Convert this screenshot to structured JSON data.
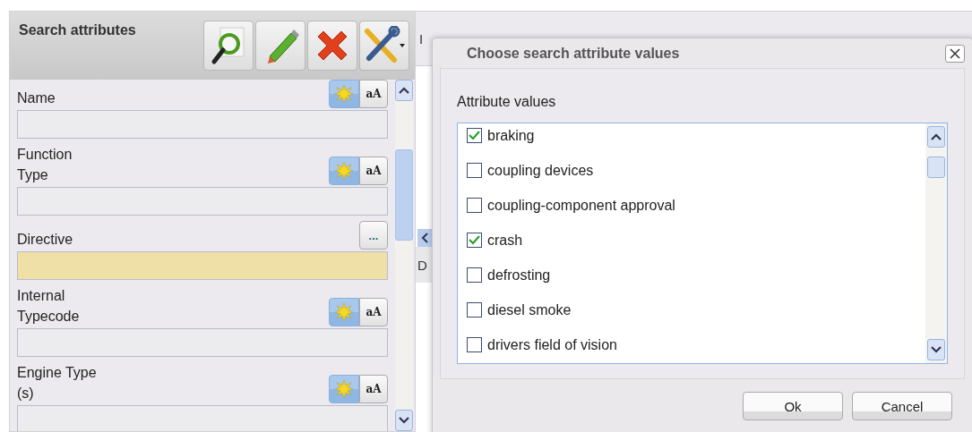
{
  "panel": {
    "title": "Search attributes",
    "toolbar": [
      {
        "kind": "search"
      },
      {
        "kind": "edit"
      },
      {
        "kind": "delete"
      },
      {
        "kind": "tools"
      }
    ],
    "fields": [
      {
        "label": "Name",
        "kind": "toggle",
        "active": true,
        "case_label": "aA",
        "highlighted": false
      },
      {
        "label": "Function\nType",
        "kind": "toggle",
        "active": true,
        "case_label": "aA",
        "highlighted": false
      },
      {
        "label": "Directive",
        "kind": "picker",
        "picker_label": "...",
        "highlighted": true
      },
      {
        "label": "Internal\nTypecode",
        "kind": "toggle",
        "active": true,
        "case_label": "aA",
        "highlighted": false
      },
      {
        "label": "Engine Type\n(s)",
        "kind": "toggle",
        "active": true,
        "case_label": "aA",
        "highlighted": false
      }
    ]
  },
  "grid": {
    "header": [
      "I"
    ],
    "row": [
      "D"
    ]
  },
  "dialog": {
    "title": "Choose search attribute values",
    "list_label": "Attribute values",
    "values": [
      {
        "label": "braking",
        "checked": true
      },
      {
        "label": "coupling devices",
        "checked": false
      },
      {
        "label": "coupling-component approval",
        "checked": false
      },
      {
        "label": "crash",
        "checked": true
      },
      {
        "label": "defrosting",
        "checked": false
      },
      {
        "label": "diesel smoke",
        "checked": false
      },
      {
        "label": "drivers field of vision",
        "checked": false
      }
    ],
    "buttons": [
      "Ok",
      "Cancel"
    ]
  }
}
